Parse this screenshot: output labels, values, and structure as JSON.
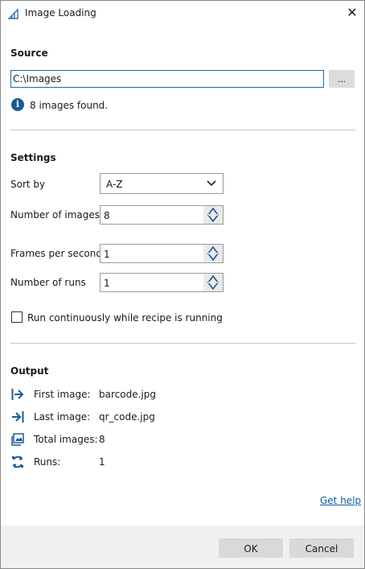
{
  "window": {
    "title": "Image Loading",
    "close_glyph": "✕"
  },
  "source": {
    "heading": "Source",
    "path_value": "C:\\Images",
    "browse_label": "...",
    "info_text": "8 images found."
  },
  "settings": {
    "heading": "Settings",
    "sort_by_label": "Sort by",
    "sort_by_value": "A-Z",
    "num_images_label": "Number of images",
    "num_images_value": "8",
    "fps_label": "Frames per second",
    "fps_value": "1",
    "num_runs_label": "Number of runs",
    "num_runs_value": "1",
    "continuous_label": "Run continuously while recipe is running",
    "continuous_checked": false
  },
  "output": {
    "heading": "Output",
    "rows": [
      {
        "label": "First image:",
        "value": "barcode.jpg",
        "icon": "first-image-icon"
      },
      {
        "label": "Last image:",
        "value": "qr_code.jpg",
        "icon": "last-image-icon"
      },
      {
        "label": "Total images:",
        "value": "8",
        "icon": "total-images-icon"
      },
      {
        "label": "Runs:",
        "value": "1",
        "icon": "runs-icon"
      }
    ]
  },
  "help_link": "Get help",
  "buttons": {
    "ok": "OK",
    "cancel": "Cancel"
  },
  "colors": {
    "accent": "#0a6fb5",
    "icon": "#1a5a97",
    "link": "#0b5fa5",
    "footer": "#f0f0f0"
  }
}
